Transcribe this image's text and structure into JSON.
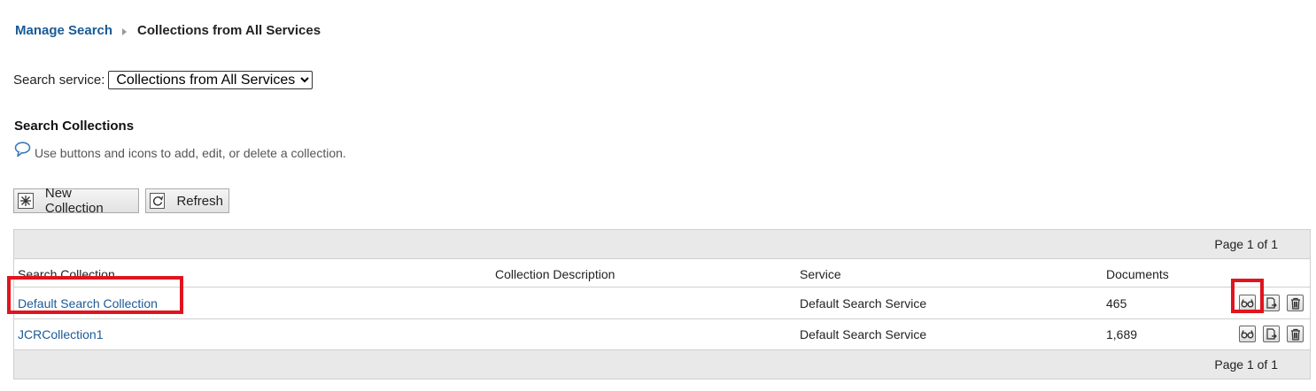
{
  "breadcrumb": {
    "root": "Manage Search",
    "current": "Collections from All Services"
  },
  "search_service": {
    "label": "Search service:",
    "selected": "Collections from All Services"
  },
  "section": {
    "title": "Search Collections",
    "help": "Use buttons and icons to add, edit, or delete a collection."
  },
  "toolbar": {
    "new_label": "New Collection",
    "refresh_label": "Refresh"
  },
  "table": {
    "pager_top": "Page 1 of 1",
    "pager_bottom": "Page 1 of 1",
    "columns": [
      "Search Collection",
      "Collection Description",
      "Service",
      "Documents"
    ],
    "rows": [
      {
        "name": "Default Search Collection",
        "description": "",
        "service": "Default Search Service",
        "documents": "465"
      },
      {
        "name": "JCRCollection1",
        "description": "",
        "service": "Default Search Service",
        "documents": "1,689"
      }
    ]
  },
  "icons": {
    "help": "speech-bubble-icon",
    "new": "new-star-icon",
    "refresh": "refresh-icon",
    "actions": [
      "view-glasses-icon",
      "export-document-icon",
      "delete-trash-icon"
    ]
  },
  "colors": {
    "link": "#1a5a96",
    "highlight": "#e0141e",
    "pager_bg": "#e9e9e9"
  }
}
